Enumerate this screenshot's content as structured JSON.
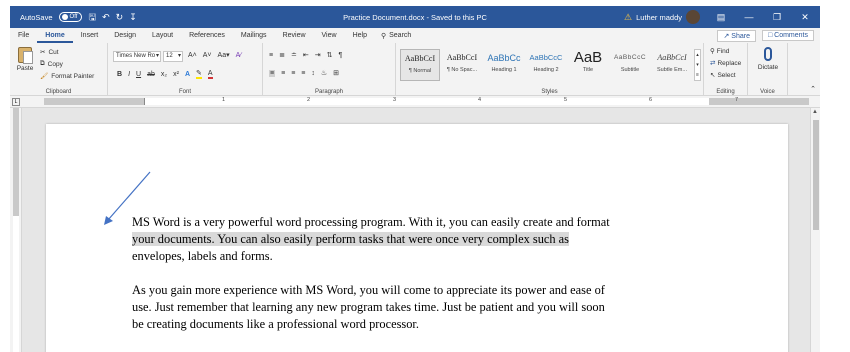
{
  "titlebar": {
    "autosave_label": "AutoSave",
    "autosave_state": "Off",
    "doc_title": "Practice Document.docx  -  Saved to this PC",
    "user_name": "Luther maddy",
    "bg_color": "#2b579a"
  },
  "menu": {
    "tabs": [
      "File",
      "Home",
      "Insert",
      "Design",
      "Layout",
      "References",
      "Mailings",
      "Review",
      "View",
      "Help"
    ],
    "active_tab": "Home",
    "search_label": "Search",
    "share_label": "Share",
    "comments_label": "Comments"
  },
  "ribbon": {
    "clipboard": {
      "paste_label": "Paste",
      "cut_label": "Cut",
      "copy_label": "Copy",
      "format_painter_label": "Format Painter",
      "group_label": "Clipboard"
    },
    "font": {
      "font_name": "Times New Ro",
      "font_size": "12",
      "group_label": "Font"
    },
    "paragraph": {
      "group_label": "Paragraph"
    },
    "styles": {
      "group_label": "Styles",
      "items": [
        {
          "sample": "AaBbCcI",
          "name": "¶ Normal"
        },
        {
          "sample": "AaBbCcI",
          "name": "¶ No Spac..."
        },
        {
          "sample": "AaBbCc",
          "name": "Heading 1"
        },
        {
          "sample": "AaBbCcC",
          "name": "Heading 2"
        },
        {
          "sample": "AaB",
          "name": "Title"
        },
        {
          "sample": "AaBbCcC",
          "name": "Subtitle"
        },
        {
          "sample": "AaBbCcI",
          "name": "Subtle Em..."
        }
      ]
    },
    "editing": {
      "find_label": "Find",
      "replace_label": "Replace",
      "select_label": "Select",
      "group_label": "Editing"
    },
    "voice": {
      "dictate_label": "Dictate",
      "group_label": "Voice"
    }
  },
  "ruler": {
    "numbers": [
      "1",
      "2",
      "3",
      "4",
      "5",
      "6",
      "7"
    ]
  },
  "document": {
    "para1_line1": "MS Word is a very powerful word processing program.  With it, you can easily create and format",
    "para1_line2": "your documents.  You can also easily perform tasks that were once very complex such as",
    "para1_line3": "envelopes, labels and forms.",
    "para2_line1": "As you gain more experience with MS Word, you will come to appreciate its power and ease of",
    "para2_line2": "use.  Just remember that learning any new program takes time.  Just be patient and you will soon",
    "para2_line3": "be creating documents like a professional word processor."
  }
}
